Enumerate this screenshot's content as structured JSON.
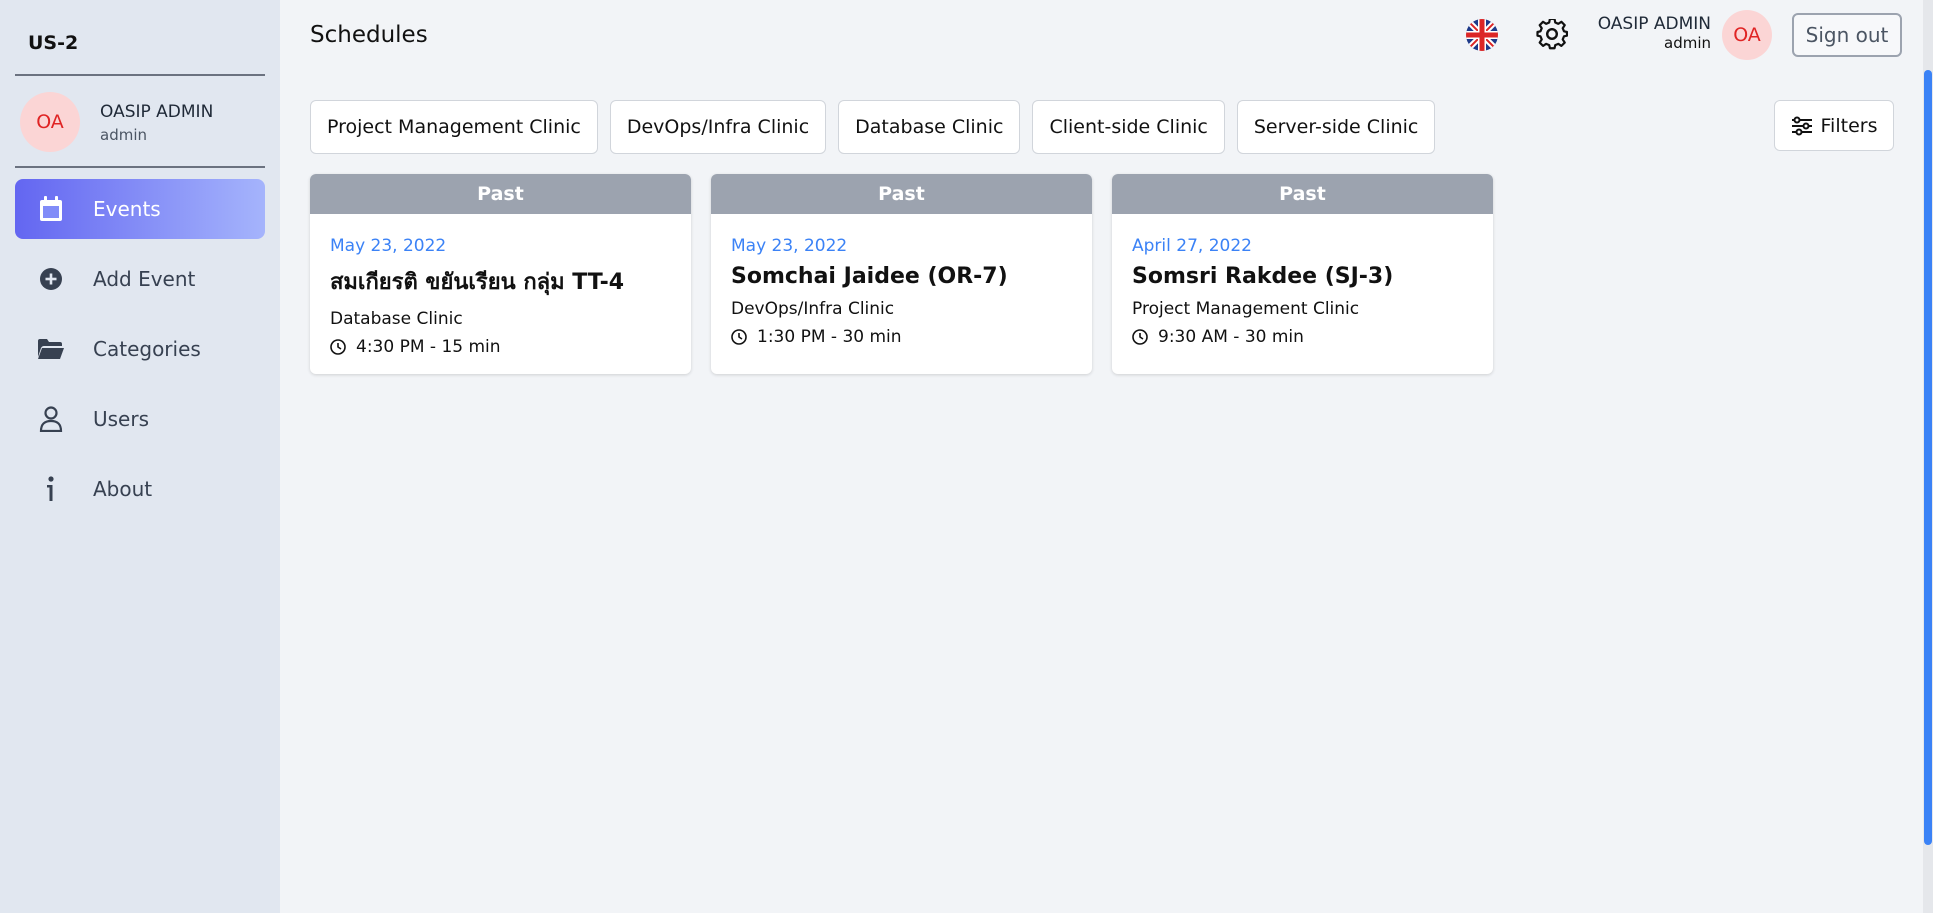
{
  "sidebar": {
    "brand": "US-2",
    "profile": {
      "initials": "OA",
      "name": "OASIP ADMIN",
      "role": "admin"
    },
    "items": [
      {
        "label": "Events",
        "icon": "calendar-icon",
        "active": true
      },
      {
        "label": "Add Event",
        "icon": "plus-circle-icon",
        "active": false
      },
      {
        "label": "Categories",
        "icon": "folder-open-icon",
        "active": false
      },
      {
        "label": "Users",
        "icon": "user-icon",
        "active": false
      },
      {
        "label": "About",
        "icon": "info-icon",
        "active": false
      }
    ]
  },
  "header": {
    "title": "Schedules",
    "language_icon": "uk-flag-icon",
    "settings_icon": "gear-icon",
    "user": {
      "name": "OASIP ADMIN",
      "role": "admin",
      "initials": "OA"
    },
    "signout_label": "Sign out"
  },
  "categories": [
    "Project Management Clinic",
    "DevOps/Infra Clinic",
    "Database Clinic",
    "Client-side Clinic",
    "Server-side Clinic"
  ],
  "filters_label": "Filters",
  "events": [
    {
      "status": "Past",
      "date": "May 23, 2022",
      "name": "สมเกียรติ ขยันเรียน กลุ่ม TT-4",
      "category": "Database Clinic",
      "time": "4:30 PM - 15 min"
    },
    {
      "status": "Past",
      "date": "May 23, 2022",
      "name": "Somchai Jaidee (OR-7)",
      "category": "DevOps/Infra Clinic",
      "time": "1:30 PM - 30 min"
    },
    {
      "status": "Past",
      "date": "April 27, 2022",
      "name": "Somsri Rakdee (SJ-3)",
      "category": "Project Management Clinic",
      "time": "9:30 AM - 30 min"
    }
  ],
  "colors": {
    "accent": "#6366f1",
    "date": "#3b82f6",
    "past_badge": "#9ca3af",
    "avatar_bg": "#fbd5d5",
    "avatar_text": "#e02424"
  }
}
